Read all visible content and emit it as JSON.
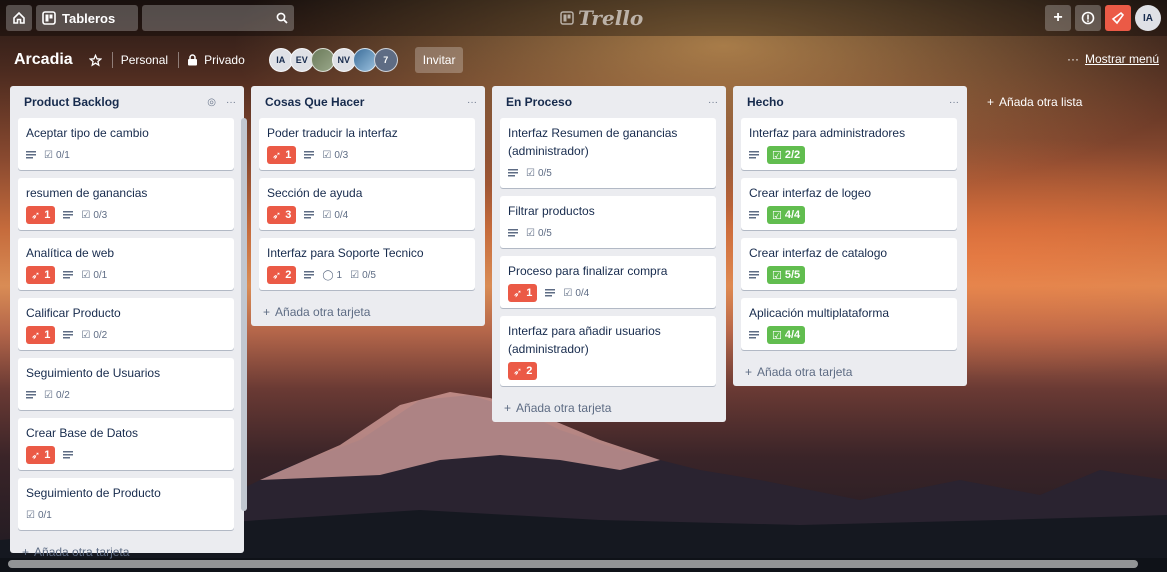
{
  "topbar": {
    "boards_label": "Tableros",
    "logo": "Trello",
    "user_initials": "IA"
  },
  "board": {
    "title": "Arcadia",
    "team": "Personal",
    "visibility": "Privado",
    "members": [
      "IA",
      "EV",
      "",
      "NV",
      ""
    ],
    "member_count": "7",
    "invite": "Invitar",
    "show_menu": "Mostrar menú"
  },
  "lists": [
    {
      "title": "Product Backlog",
      "add_card": "Añada otra tarjeta",
      "cards": [
        {
          "title": "Aceptar tipo de cambio",
          "labels": "",
          "checklist": "0/1"
        },
        {
          "title": "resumen de ganancias",
          "labels": "1",
          "checklist": "0/3"
        },
        {
          "title": "Analítica de web",
          "labels": "1",
          "checklist": "0/1"
        },
        {
          "title": "Calificar Producto",
          "labels": "1",
          "checklist": "0/2"
        },
        {
          "title": "Seguimiento de Usuarios",
          "labels": "",
          "checklist": "0/2"
        },
        {
          "title": "Crear Base de Datos",
          "labels": "1",
          "checklist": ""
        },
        {
          "title": "Seguimiento de Producto",
          "labels": "",
          "checklist": "0/1"
        }
      ]
    },
    {
      "title": "Cosas Que Hacer",
      "add_card": "Añada otra tarjeta",
      "cards": [
        {
          "title": "Poder traducir la interfaz",
          "labels": "1",
          "checklist": "0/3"
        },
        {
          "title": "Sección de ayuda",
          "labels": "3",
          "checklist": "0/4"
        },
        {
          "title": "Interfaz para Soporte Tecnico",
          "labels": "2",
          "comments": "1",
          "checklist": "0/5"
        }
      ]
    },
    {
      "title": "En Proceso",
      "add_card": "Añada otra tarjeta",
      "cards": [
        {
          "title": "Interfaz Resumen de ganancias (administrador)",
          "labels": "",
          "checklist": "0/5"
        },
        {
          "title": "Filtrar productos",
          "labels": "",
          "checklist": "0/5"
        },
        {
          "title": "Proceso para finalizar compra",
          "labels": "1",
          "checklist": "0/4"
        },
        {
          "title": "Interfaz para añadir usuarios (administrador)",
          "labels": "2",
          "checklist": ""
        }
      ]
    },
    {
      "title": "Hecho",
      "add_card": "Añada otra tarjeta",
      "cards": [
        {
          "title": "Interfaz para administradores",
          "checklist": "2/2"
        },
        {
          "title": "Crear interfaz de logeo",
          "checklist": "4/4"
        },
        {
          "title": "Crear interfaz de catalogo",
          "checklist": "5/5"
        },
        {
          "title": "Aplicación multiplataforma",
          "checklist": "4/4"
        }
      ]
    }
  ],
  "add_list": "Añada otra lista",
  "colors": {
    "label_red": "#eb5a46",
    "label_green": "#61bd4f",
    "list_bg": "#ebecf0"
  }
}
